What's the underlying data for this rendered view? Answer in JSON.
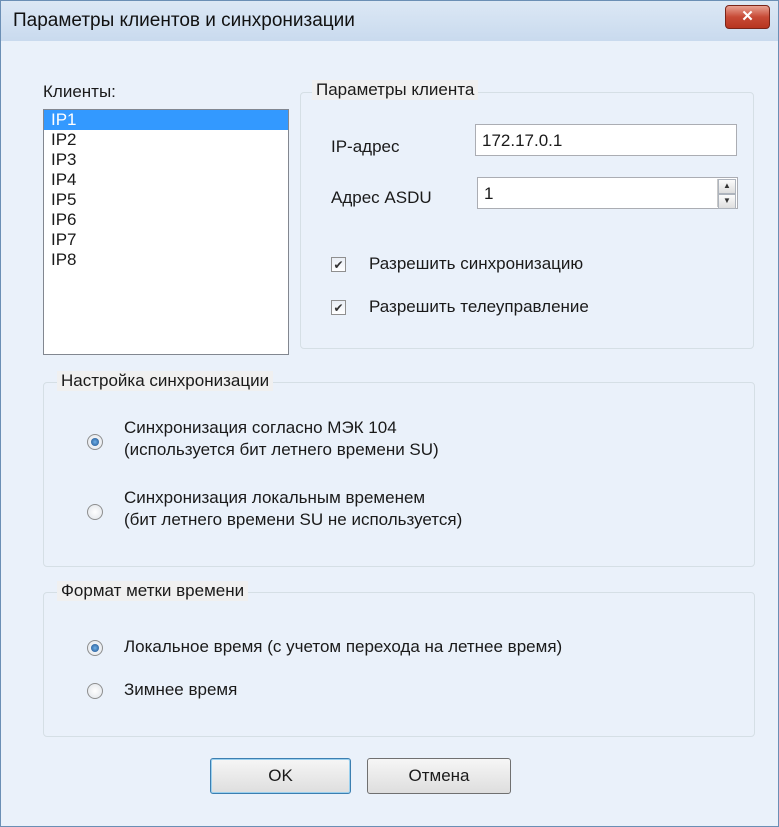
{
  "window": {
    "title": "Параметры клиентов и синхронизации",
    "close_icon": "✕"
  },
  "clients": {
    "label": "Клиенты:",
    "items": [
      "IP1",
      "IP2",
      "IP3",
      "IP4",
      "IP5",
      "IP6",
      "IP7",
      "IP8"
    ],
    "selected": "IP1"
  },
  "client_params": {
    "group_label": "Параметры клиента",
    "ip_label": "IP-адрес",
    "ip_value": "172.17.0.1",
    "asdu_label": "Адрес ASDU",
    "asdu_value": "1",
    "allow_sync_label": "Разрешить синхронизацию",
    "allow_sync_checked": true,
    "allow_telecontrol_label": "Разрешить телеуправление",
    "allow_telecontrol_checked": true
  },
  "sync_settings": {
    "group_label": "Настройка синхронизации",
    "option1_line1": "Синхронизация согласно МЭК 104",
    "option1_line2": "(используется бит летнего времени SU)",
    "option2_line1": "Синхронизация локальным временем",
    "option2_line2": "(бит летнего времени SU не используется)",
    "selected": 1
  },
  "timestamp_format": {
    "group_label": "Формат метки времени",
    "option1": "Локальное время (с учетом перехода на летнее время)",
    "option2": "Зимнее время",
    "selected": 1
  },
  "buttons": {
    "ok": "OK",
    "cancel": "Отмена"
  }
}
